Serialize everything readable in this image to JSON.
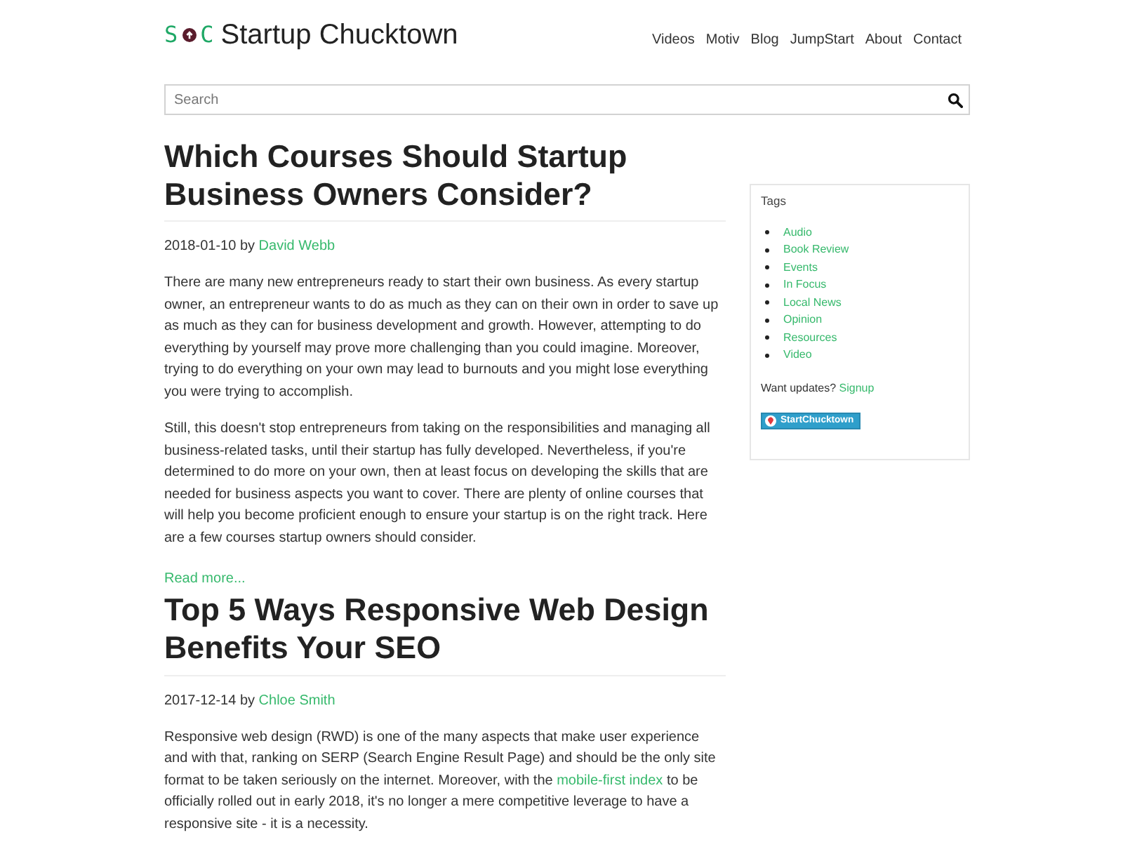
{
  "header": {
    "logo": {
      "left_letter": "S",
      "right_letter": "C"
    },
    "site_title": "Startup Chucktown",
    "nav": [
      "Videos",
      "Motiv",
      "Blog",
      "JumpStart",
      "About",
      "Contact"
    ]
  },
  "search": {
    "placeholder": "Search"
  },
  "articles": [
    {
      "title": "Which Courses Should Startup Business Owners Consider?",
      "date": "2018-01-10",
      "by_label": "by",
      "author": "David Webb",
      "paragraphs": [
        [
          {
            "kind": "text",
            "text": "There are many new entrepreneurs ready to start their own business. As every startup owner, an entrepreneur wants to do as much as they can on their own in order to save up as much as they can for business development and growth. However, attempting to do everything by yourself may prove more challenging than you could imagine. Moreover, trying to do everything on your own may lead to burnouts and you might lose everything you were trying to accomplish."
          }
        ],
        [
          {
            "kind": "text",
            "text": "Still, this doesn't stop entrepreneurs from taking on the responsibilities and managing all business-related tasks, until their startup has fully developed. Nevertheless, if you're determined to do more on your own, then at least focus on developing the skills that are needed for business aspects you want to cover. There are plenty of online courses that will help you become proficient enough to ensure your startup is on the right track. Here are a few courses startup owners should consider."
          }
        ]
      ],
      "read_more": "Read more..."
    },
    {
      "title": "Top 5 Ways Responsive Web Design Benefits Your SEO",
      "date": "2017-12-14",
      "by_label": "by",
      "author": "Chloe Smith",
      "paragraphs": [
        [
          {
            "kind": "text",
            "text": "Responsive web design (RWD) is one of the many aspects that make user experience and with that, ranking on SERP (Search Engine Result Page) and should be the only site format to be taken seriously on the internet. Moreover, with the "
          },
          {
            "kind": "link",
            "text": "mobile-first index"
          },
          {
            "kind": "text",
            "text": " to be officially rolled out in early 2018, it's no longer a mere competitive leverage to have a responsive site - it is a necessity."
          }
        ]
      ]
    }
  ],
  "sidebar": {
    "heading": "Tags",
    "tags": [
      "Audio",
      "Book Review",
      "Events",
      "In Focus",
      "Local News",
      "Opinion",
      "Resources",
      "Video"
    ],
    "updates_text": "Want updates?",
    "signup": "Signup",
    "badge": "StartChucktown"
  }
}
